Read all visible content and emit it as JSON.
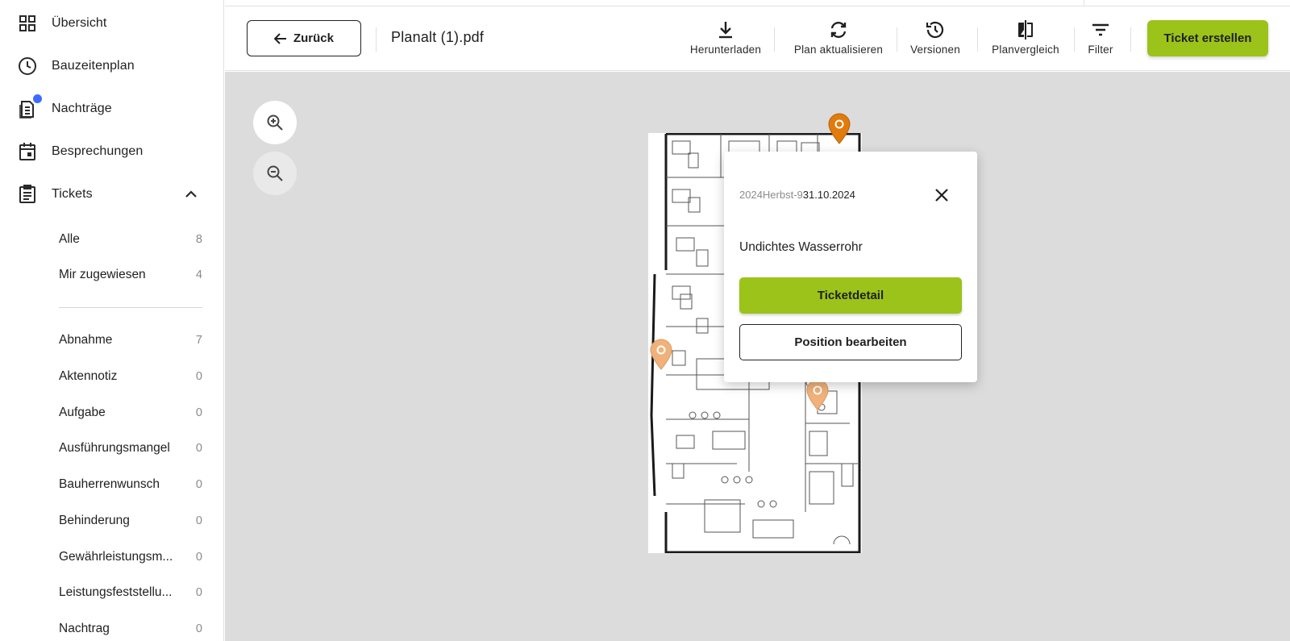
{
  "sidebar": {
    "nav": [
      {
        "label": "Übersicht",
        "icon": "dashboard-grid-icon"
      },
      {
        "label": "Bauzeitenplan",
        "icon": "clock-icon"
      },
      {
        "label": "Nachträge",
        "icon": "document-list-icon",
        "has_notification": true
      },
      {
        "label": "Besprechungen",
        "icon": "calendar-icon"
      },
      {
        "label": "Tickets",
        "icon": "clipboard-icon",
        "expanded": true
      }
    ],
    "ticket_filters": [
      {
        "label": "Alle",
        "count": "8"
      },
      {
        "label": "Mir zugewiesen",
        "count": "4"
      }
    ],
    "ticket_types": [
      {
        "label": "Abnahme",
        "count": "7"
      },
      {
        "label": "Aktennotiz",
        "count": "0"
      },
      {
        "label": "Aufgabe",
        "count": "0"
      },
      {
        "label": "Ausführungsmangel",
        "count": "0"
      },
      {
        "label": "Bauherrenwunsch",
        "count": "0"
      },
      {
        "label": "Behinderung",
        "count": "0"
      },
      {
        "label": "Gewährleistungsm...",
        "count": "0"
      },
      {
        "label": "Leistungsfeststellu...",
        "count": "0"
      },
      {
        "label": "Nachtrag",
        "count": "0"
      }
    ]
  },
  "toolbar": {
    "back_label": "Zurück",
    "file_title": "Planalt (1).pdf",
    "tools": [
      {
        "label": "Herunterladen",
        "icon": "download-icon"
      },
      {
        "label": "Plan aktualisieren",
        "icon": "refresh-icon"
      },
      {
        "label": "Versionen",
        "icon": "history-icon"
      },
      {
        "label": "Planvergleich",
        "icon": "compare-icon"
      },
      {
        "label": "Filter",
        "icon": "filter-icon"
      }
    ],
    "create_label": "Ticket erstellen"
  },
  "popup": {
    "ticket_id": "2024Herbst-9",
    "date": "31.10.2024",
    "title": "Undichtes Wasserrohr",
    "detail_label": "Ticketdetail",
    "position_label": "Position bearbeiten"
  },
  "colors": {
    "accent": "#9cc31a",
    "pin_active": "#e07b0c",
    "pin_inactive": "#f0b27a",
    "notification": "#3d6bff",
    "canvas": "#dcdcdc"
  }
}
